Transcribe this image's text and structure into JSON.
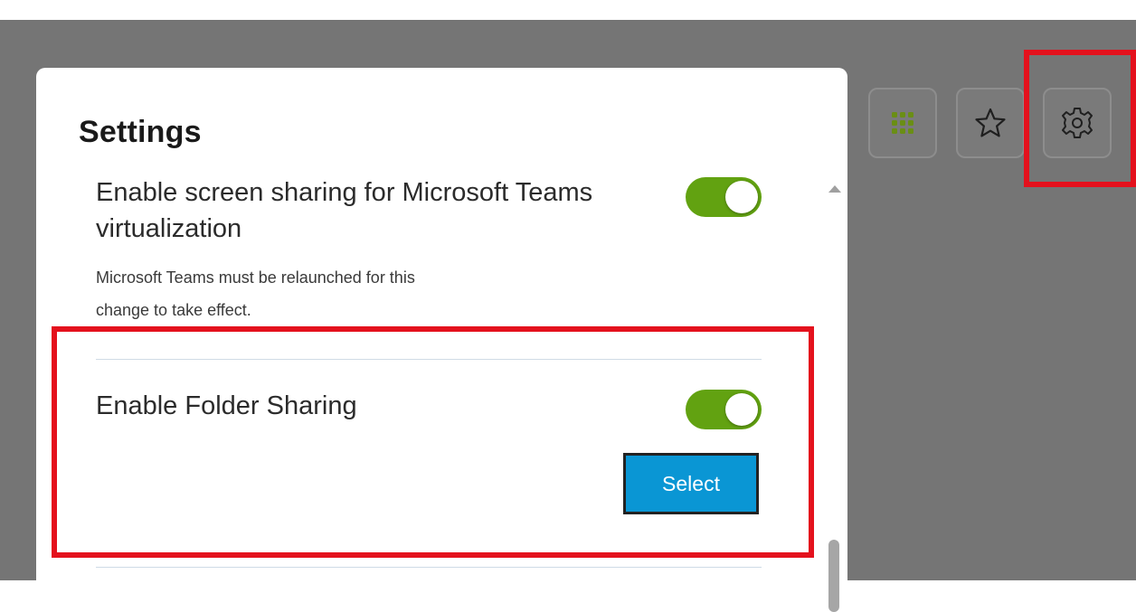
{
  "settings": {
    "title": "Settings",
    "teams_screen_sharing": {
      "label_line1": "Enable screen sharing for Microsoft Teams",
      "label_line2": "virtualization",
      "note_line1": "Microsoft Teams must be relaunched for this",
      "note_line2": "change to take effect.",
      "enabled": true
    },
    "folder_sharing": {
      "label": "Enable Folder Sharing",
      "enabled": true,
      "select_label": "Select"
    }
  },
  "toolbar": {
    "buttons": [
      {
        "icon": "apps-grid-icon"
      },
      {
        "icon": "star-icon"
      },
      {
        "icon": "gear-icon"
      }
    ]
  },
  "colors": {
    "toggle_on": "#62a211",
    "select_button": "#0a96d4",
    "highlight": "#e4111d",
    "apps_icon": "#6a8e15"
  }
}
